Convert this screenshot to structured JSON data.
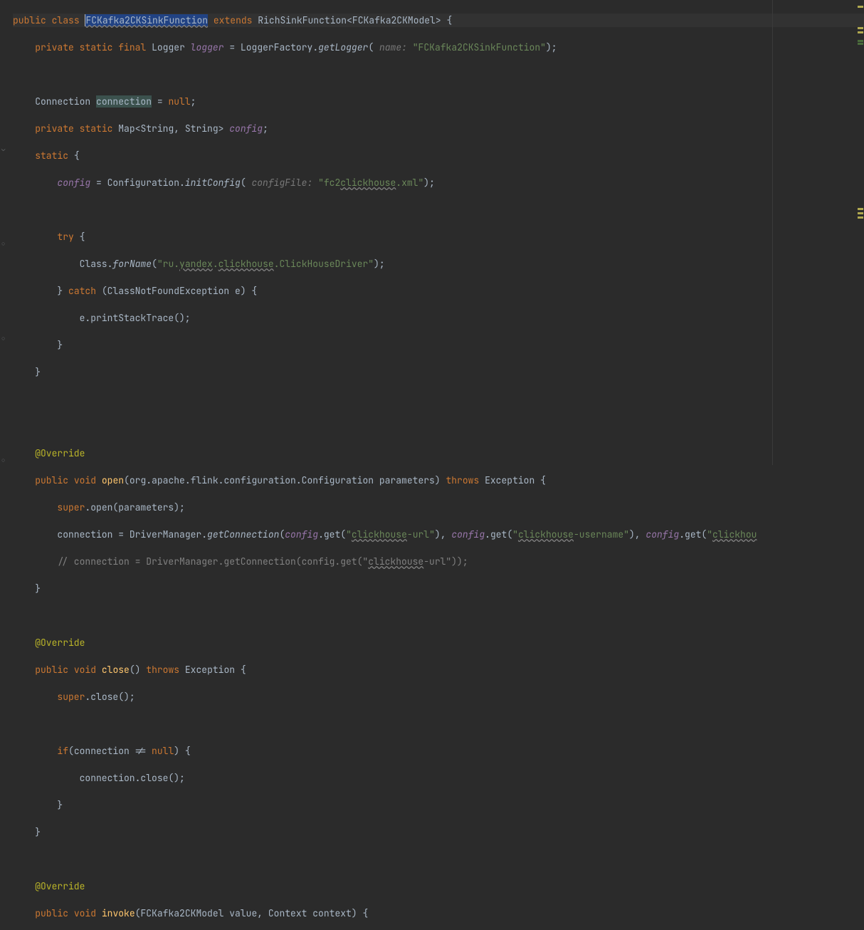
{
  "code": {
    "l1_public": "public",
    "l1_class": "class",
    "l1_name": "FCKafka2CKSinkFunction",
    "l1_extends": "extends",
    "l1_super": "RichSinkFunction<FCKafka2CKModel> {",
    "l2_private": "private",
    "l2_static": "static",
    "l2_final": "final",
    "l2_logger_type": "Logger",
    "l2_logger_var": "logger",
    "l2_eq": " = LoggerFactory.",
    "l2_getlogger": "getLogger",
    "l2_hint": " name: ",
    "l2_str": "\"FCKafka2CKSinkFunction\"",
    "l2_end": ");",
    "l4_conn_type": "Connection ",
    "l4_conn_var": "connection",
    "l4_rest": " = ",
    "l4_null": "null",
    "l4_sc": ";",
    "l5_private": "private",
    "l5_static": "static",
    "l5_map": " Map<String, String> ",
    "l5_config": "config",
    "l5_sc": ";",
    "l6_static": "static",
    "l6_brace": " {",
    "l7_config": "config",
    "l7_eq": " = Configuration.",
    "l7_init": "initConfig",
    "l7_hint": " configFile: ",
    "l7_str_a": "\"fc2",
    "l7_str_b": "clickhouse",
    "l7_str_c": ".xml\"",
    "l7_end": ");",
    "l9_try": "try",
    "l9_brace": " {",
    "l10_class": "Class.",
    "l10_forname": "forName",
    "l10_paren": "(",
    "l10_str_a": "\"ru.",
    "l10_str_b": "yandex",
    "l10_str_c": ".",
    "l10_str_d": "clickhouse",
    "l10_str_e": ".ClickHouseDriver\"",
    "l10_end": ");",
    "l11_catch": "catch",
    "l11_rest": " (ClassNotFoundException e) {",
    "l12": "e.printStackTrace();",
    "l13": "}",
    "l14": "}",
    "l17_anno": "@Override",
    "l18_public": "public",
    "l18_void": "void",
    "l18_open": "open",
    "l18_params": "(org.apache.flink.configuration.Configuration parameters) ",
    "l18_throws": "throws",
    "l18_exc": " Exception {",
    "l19_super": "super",
    "l19_rest": ".open(parameters);",
    "l20_conn": "connection",
    "l20_eq": " = DriverManager.",
    "l20_getconn": "getConnection",
    "l20_paren": "(",
    "l20_config1": "config",
    "l20_get1": ".get(",
    "l20_s1a": "\"",
    "l20_s1b": "clickhouse",
    "l20_s1c": "-url\"",
    "l20_c1": "), ",
    "l20_config2": "config",
    "l20_get2": ".get(",
    "l20_s2a": "\"",
    "l20_s2b": "clickhouse",
    "l20_s2c": "-username\"",
    "l20_c2": "), ",
    "l20_config3": "config",
    "l20_get3": ".get(",
    "l20_s3a": "\"",
    "l20_s3b": "clickhou",
    "l21_comment": "// connection = DriverManager.getConnection(config.get(\"",
    "l21_comment_b": "clickhouse",
    "l21_comment_c": "-url\"));",
    "l22": "}",
    "l24_anno": "@Override",
    "l25_public": "public",
    "l25_void": "void",
    "l25_close": "close",
    "l25_params": "() ",
    "l25_throws": "throws",
    "l25_exc": " Exception {",
    "l26_super": "super",
    "l26_rest": ".close();",
    "l28_if": "if",
    "l28_paren": "(",
    "l28_conn": "connection",
    "l28_rest": " != ",
    "l28_null": "null",
    "l28_end": ") {",
    "l29_conn": "connection",
    "l29_rest": ".close();",
    "l30": "}",
    "l31": "}",
    "l33_anno": "@Override",
    "l34_public": "public",
    "l34_void": "void",
    "l34_invoke": "invoke",
    "l34_params": "(FCKafka2CKModel value, Context context) {"
  }
}
